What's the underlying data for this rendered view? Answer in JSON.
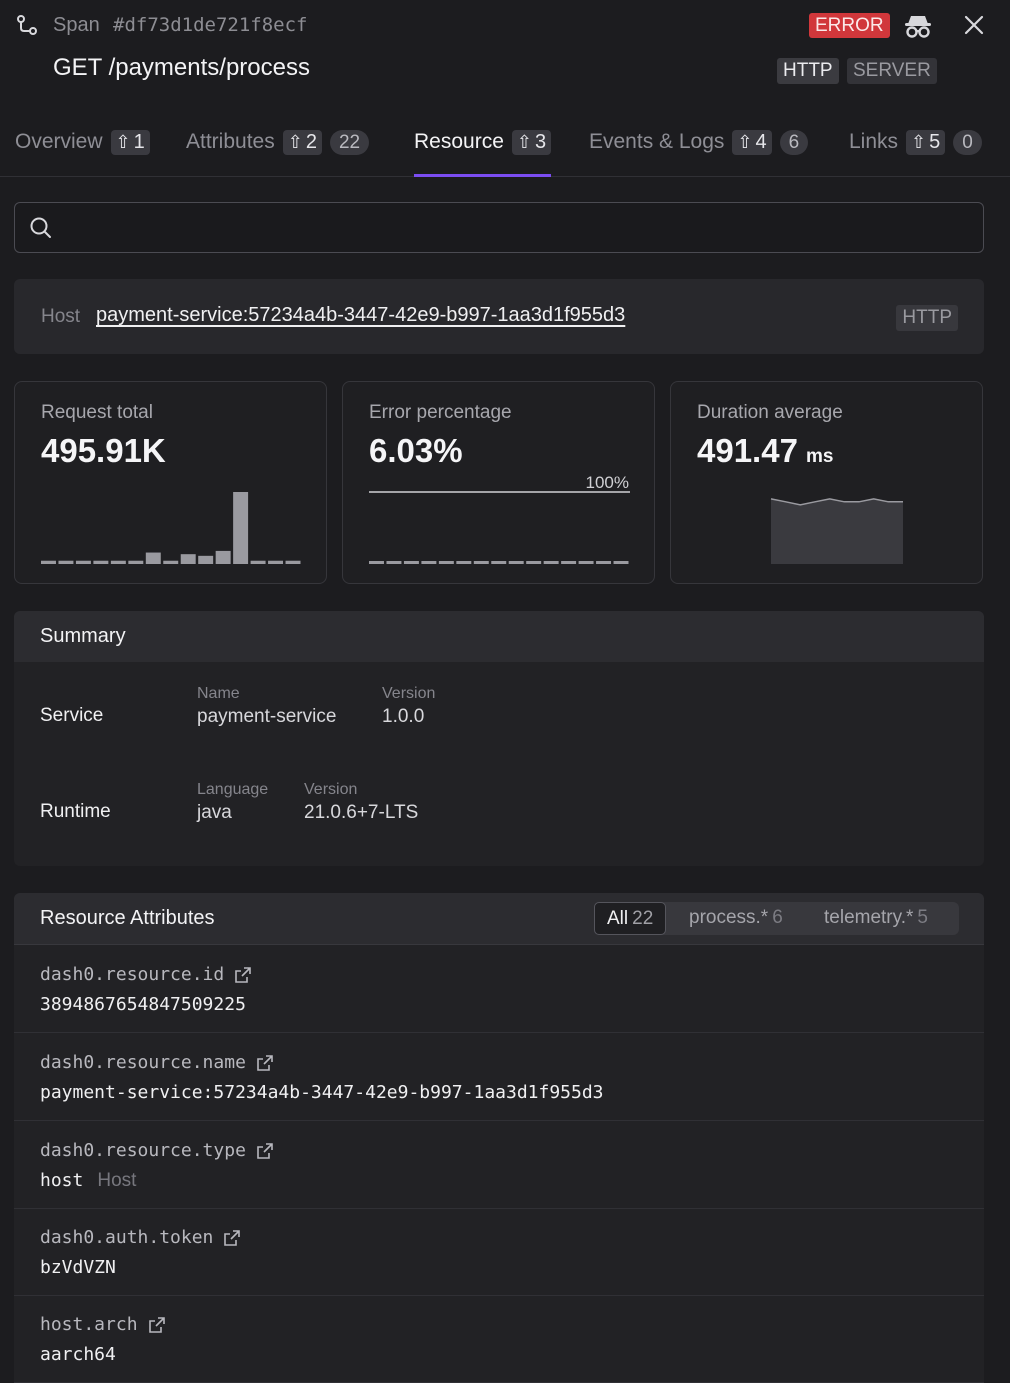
{
  "header": {
    "kind": "Span",
    "span_id": "#df73d1de721f8ecf",
    "status": "ERROR",
    "title": "GET /payments/process",
    "tags": [
      "HTTP",
      "SERVER"
    ]
  },
  "tabs": [
    {
      "label": "Overview",
      "shortcut": "1",
      "count": null,
      "active": false
    },
    {
      "label": "Attributes",
      "shortcut": "2",
      "count": "22",
      "active": false
    },
    {
      "label": "Resource",
      "shortcut": "3",
      "count": null,
      "active": true
    },
    {
      "label": "Events & Logs",
      "shortcut": "4",
      "count": "6",
      "active": false
    },
    {
      "label": "Links",
      "shortcut": "5",
      "count": "0",
      "active": false
    }
  ],
  "search": {
    "value": "",
    "placeholder": ""
  },
  "host": {
    "label": "Host",
    "value": "payment-service:57234a4b-3447-42e9-b997-1aa3d1f955d3",
    "tag": "HTTP"
  },
  "metrics": {
    "request_total": {
      "label": "Request total",
      "value": "495.91K"
    },
    "error_percentage": {
      "label": "Error percentage",
      "value": "6.03%",
      "ref_label": "100%"
    },
    "duration_average": {
      "label": "Duration average",
      "value": "491.47",
      "unit": "ms"
    }
  },
  "chart_data": [
    {
      "type": "bar",
      "title": "Request total",
      "categories": [
        "1",
        "2",
        "3",
        "4",
        "5",
        "6",
        "7",
        "8",
        "9",
        "10",
        "11",
        "12",
        "13",
        "14",
        "15"
      ],
      "values": [
        1,
        1,
        1,
        1,
        1,
        1,
        3.5,
        1,
        3,
        2.5,
        4,
        22,
        1,
        1,
        1
      ]
    },
    {
      "type": "bar",
      "title": "Error percentage",
      "reference_line": 100,
      "categories": [
        "1",
        "2",
        "3",
        "4",
        "5",
        "6",
        "7",
        "8",
        "9",
        "10",
        "11",
        "12",
        "13",
        "14",
        "15"
      ],
      "values": [
        0,
        0,
        0,
        0,
        0,
        0,
        0,
        0,
        0,
        0,
        0,
        0,
        0,
        0,
        0
      ]
    },
    {
      "type": "area",
      "title": "Duration average",
      "values": [
        492,
        491,
        490,
        491,
        492,
        491,
        491,
        492,
        491,
        491
      ]
    }
  ],
  "summary": {
    "title": "Summary",
    "service": {
      "label": "Service",
      "name_key": "Name",
      "name": "payment-service",
      "version_key": "Version",
      "version": "1.0.0"
    },
    "runtime": {
      "label": "Runtime",
      "language_key": "Language",
      "language": "java",
      "version_key": "Version",
      "version": "21.0.6+7-LTS"
    }
  },
  "resource_attributes": {
    "title": "Resource Attributes",
    "filters": [
      {
        "label": "All",
        "count": "22"
      },
      {
        "label": "process.*",
        "count": "6"
      },
      {
        "label": "telemetry.*",
        "count": "5"
      }
    ],
    "rows": [
      {
        "key": "dash0.resource.id",
        "value": "3894867654847509225",
        "hint": ""
      },
      {
        "key": "dash0.resource.name",
        "value": "payment-service:57234a4b-3447-42e9-b997-1aa3d1f955d3",
        "hint": ""
      },
      {
        "key": "dash0.resource.type",
        "value": "host",
        "hint": "Host"
      },
      {
        "key": "dash0.auth.token",
        "value": "bzVdVZN",
        "hint": ""
      },
      {
        "key": "host.arch",
        "value": "aarch64",
        "hint": ""
      }
    ]
  },
  "colors": {
    "accent": "#7b4df2",
    "error": "#d1373b",
    "bar": "#9a9aa0"
  }
}
